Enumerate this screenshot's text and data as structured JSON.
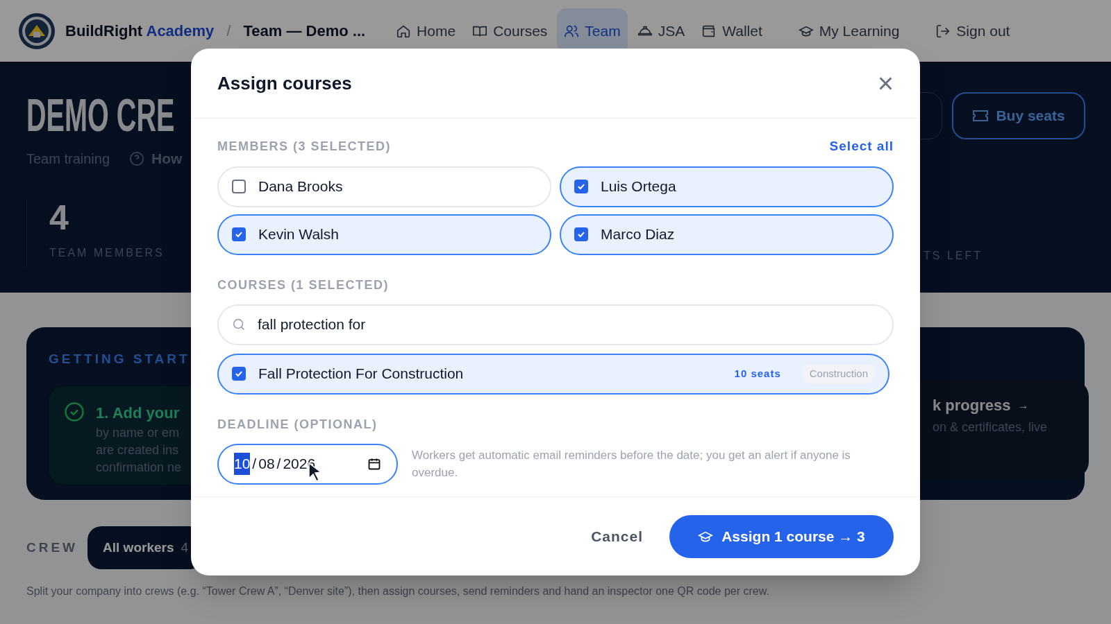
{
  "nav": {
    "brand": "BuildRight",
    "brand_accent": "Academy",
    "separator": "/",
    "page": "Team — Demo ...",
    "items": [
      {
        "label": "Home",
        "selected": false
      },
      {
        "label": "Courses",
        "selected": false
      },
      {
        "label": "Team",
        "selected": true
      },
      {
        "label": "JSA",
        "selected": false
      },
      {
        "label": "Wallet",
        "selected": false
      },
      {
        "label": "My Learning",
        "selected": false
      },
      {
        "label": "Sign out",
        "selected": false
      }
    ]
  },
  "hero": {
    "title": "DEMO CRE",
    "subtitle": "Team training",
    "help_link": "How",
    "buy_button": "Buy seats",
    "stats": [
      {
        "value": "4",
        "label": "TEAM MEMBERS"
      }
    ],
    "right_stat_label": "TS LEFT"
  },
  "getting_started": {
    "title": "GETTING START",
    "steps": [
      {
        "title": "1. Add your",
        "done": true,
        "lines": [
          "by name or em",
          "are created ins",
          "confirmation ne"
        ]
      }
    ],
    "right_step": {
      "title": "k progress",
      "arrow": "→",
      "line": "on & certificates, live"
    }
  },
  "crew": {
    "label": "CREW",
    "tabs": [
      {
        "label": "All workers",
        "count": "4",
        "selected": true
      }
    ],
    "note": "Split your company into crews (e.g. “Tower Crew A”, “Denver site”), then assign courses, send reminders and hand an inspector one QR code per crew."
  },
  "modal": {
    "title": "Assign courses",
    "close": "×",
    "members_label": "MEMBERS (3 SELECTED)",
    "select_all": "Select all",
    "members": [
      {
        "name": "Dana Brooks",
        "checked": false
      },
      {
        "name": "Luis Ortega",
        "checked": true
      },
      {
        "name": "Kevin Walsh",
        "checked": true
      },
      {
        "name": "Marco Diaz",
        "checked": true
      }
    ],
    "courses_label": "COURSES (1 SELECTED)",
    "search": {
      "value": "fall protection for"
    },
    "courses": [
      {
        "name": "Fall Protection For Construction",
        "checked": true,
        "seats": "10 seats",
        "tag": "Construction"
      }
    ],
    "deadline_label": "DEADLINE (OPTIONAL)",
    "date": {
      "separator": "/",
      "segments": [
        {
          "text": "10",
          "selected": true
        },
        {
          "text": "08",
          "selected": false
        },
        {
          "text": "2026",
          "selected": false
        }
      ]
    },
    "deadline_help": "Workers get automatic email reminders before the date; you get an alert if anyone is overdue.",
    "cancel": "Cancel",
    "assign": "Assign 1 course → 3"
  }
}
